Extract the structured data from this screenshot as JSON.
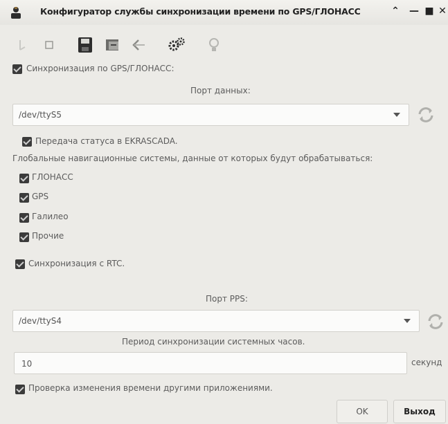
{
  "window": {
    "title": "Конфигуратор службы синхронизации времени по GPS/ГЛОНАСС"
  },
  "toolbar": {
    "icons": [
      "back-icon",
      "stop-icon",
      "save-icon",
      "load-icon",
      "undo-icon",
      "settings-icon",
      "info-icon"
    ]
  },
  "gps": {
    "sync_label": "Синхронизация по GPS/ГЛОНАСС:",
    "data_port_label": "Порт данных:",
    "data_port_value": "/dev/ttyS5",
    "ekrascada_label": "Передача статуса в EKRASCADA.",
    "systems_label": "Глобальные навигационные системы, данные от которых будут обрабатываться:",
    "systems": [
      "ГЛОНАСС",
      "GPS",
      "Галилео",
      "Прочие"
    ]
  },
  "rtc": {
    "sync_label": "Синхронизация с RTC."
  },
  "pps": {
    "port_label": "Порт PPS:",
    "port_value": "/dev/ttyS4",
    "period_label": "Период синхронизации системных часов.",
    "period_value": "10",
    "period_unit": "секунд",
    "check_label": "Проверка изменения времени другими приложениями."
  },
  "buttons": {
    "ok": "OK",
    "exit": "Выход"
  }
}
